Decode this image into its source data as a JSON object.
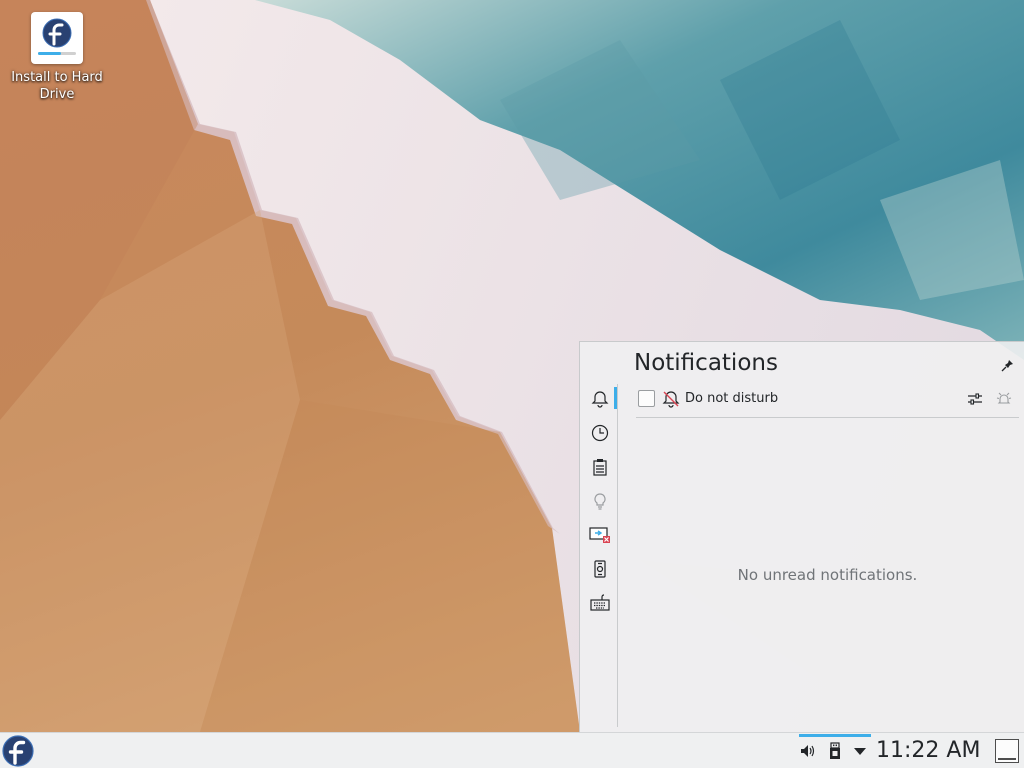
{
  "desktop": {
    "icons": [
      {
        "label": "Install to Hard Drive",
        "icon": "fedora-installer-icon"
      }
    ]
  },
  "notifications_popup": {
    "title": "Notifications",
    "pin_icon": "pin-icon",
    "sidebar": [
      {
        "icon": "bell-icon",
        "active": true
      },
      {
        "icon": "clock-icon",
        "active": false
      },
      {
        "icon": "clipboard-icon",
        "active": false
      },
      {
        "icon": "lightbulb-icon",
        "active": false
      },
      {
        "icon": "display-disabled-icon",
        "active": false
      },
      {
        "icon": "device-icon",
        "active": false
      },
      {
        "icon": "keyboard-icon",
        "active": false
      }
    ],
    "do_not_disturb": {
      "label": "Do not disturb",
      "checked": false
    },
    "configure_icon": "sliders-icon",
    "clear_icon": "clear-all-icon",
    "empty_message": "No unread notifications."
  },
  "taskbar": {
    "launcher_icon": "fedora-logo-icon",
    "tray": [
      {
        "icon": "volume-icon"
      },
      {
        "icon": "usb-device-icon"
      },
      {
        "icon": "expand-arrow-icon"
      }
    ],
    "clock": "11:22 AM",
    "show_desktop_icon": "show-desktop-icon"
  },
  "colors": {
    "accent": "#3daee9",
    "panel_bg": "#eff0f1",
    "text": "#232629",
    "muted_text": "#707478",
    "fedora_blue": "#294172"
  }
}
